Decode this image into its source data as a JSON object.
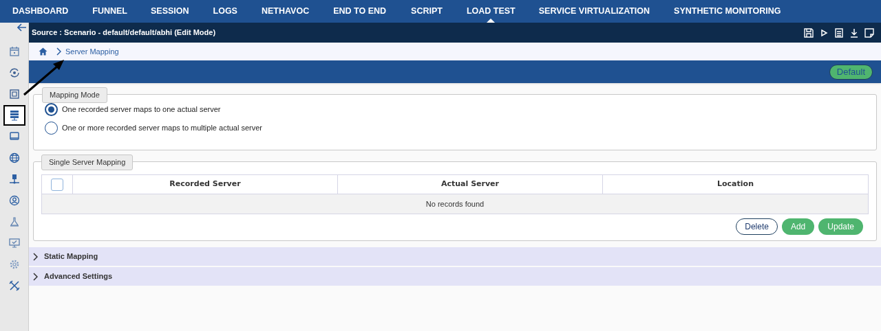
{
  "nav": [
    {
      "label": "DASHBOARD",
      "selected": false
    },
    {
      "label": "FUNNEL",
      "selected": false
    },
    {
      "label": "SESSION",
      "selected": false
    },
    {
      "label": "LOGS",
      "selected": false
    },
    {
      "label": "NETHAVOC",
      "selected": false
    },
    {
      "label": "END TO END",
      "selected": false
    },
    {
      "label": "SCRIPT",
      "selected": false
    },
    {
      "label": "LOAD TEST",
      "selected": true
    },
    {
      "label": "SERVICE VIRTUALIZATION",
      "selected": false
    },
    {
      "label": "SYNTHETIC MONITORING",
      "selected": false
    }
  ],
  "sidebar": {
    "items": [
      {
        "selected": false
      },
      {
        "selected": false
      },
      {
        "selected": false
      },
      {
        "selected": true
      },
      {
        "selected": false
      },
      {
        "selected": false
      },
      {
        "selected": false
      },
      {
        "selected": false
      },
      {
        "selected": false
      },
      {
        "selected": false
      },
      {
        "selected": false
      },
      {
        "selected": false
      }
    ]
  },
  "source_bar": {
    "title": "Source : Scenario - default/default/abhi (Edit Mode)"
  },
  "breadcrumb": [
    "Server Mapping"
  ],
  "default_button": "Default",
  "mapping_mode": {
    "legend": "Mapping Mode",
    "options": [
      {
        "label": "One recorded server maps to one actual server",
        "selected": true
      },
      {
        "label": "One or more recorded server maps to multiple actual server",
        "selected": false
      }
    ]
  },
  "single_server_mapping": {
    "legend": "Single Server Mapping",
    "select_all_checked": false,
    "table": {
      "columns": [
        "Recorded Server",
        "Actual Server",
        "Location"
      ],
      "empty_message": "No records found"
    },
    "buttons": [
      {
        "label": "Delete",
        "kind": "outline"
      },
      {
        "label": "Add",
        "kind": "primary"
      },
      {
        "label": "Update",
        "kind": "primary"
      }
    ]
  },
  "sections": [
    {
      "label": "Static Mapping",
      "expanded": false
    },
    {
      "label": "Advanced Settings",
      "expanded": false
    }
  ]
}
